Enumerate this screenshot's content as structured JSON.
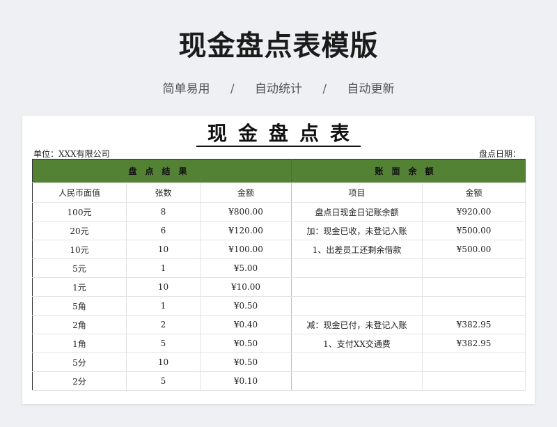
{
  "header": {
    "title": "现金盘点表模版",
    "features": [
      "简单易用",
      "自动统计",
      "自动更新"
    ],
    "separator": "/"
  },
  "sheet": {
    "title": "现金盘点表",
    "unit_label": "单位：XXX有限公司",
    "date_label": "盘点日期：",
    "section_left": "盘点结果",
    "section_right": "账面余额",
    "columns": [
      "人民币面值",
      "张数",
      "金额",
      "项目",
      "金额"
    ],
    "rows": [
      {
        "denom": "100元",
        "count": "8",
        "amount": "¥800.00",
        "item": "盘点日现金日记账余额",
        "item_amount": "¥920.00"
      },
      {
        "denom": "20元",
        "count": "6",
        "amount": "¥120.00",
        "item": "加：现金已收，未登记入账",
        "item_amount": "¥500.00"
      },
      {
        "denom": "10元",
        "count": "10",
        "amount": "¥100.00",
        "item": "1、出差员工还剩余借款",
        "item_amount": "¥500.00"
      },
      {
        "denom": "5元",
        "count": "1",
        "amount": "¥5.00",
        "item": "",
        "item_amount": ""
      },
      {
        "denom": "1元",
        "count": "10",
        "amount": "¥10.00",
        "item": "",
        "item_amount": ""
      },
      {
        "denom": "5角",
        "count": "1",
        "amount": "¥0.50",
        "item": "",
        "item_amount": ""
      },
      {
        "denom": "2角",
        "count": "2",
        "amount": "¥0.40",
        "item": "减：现金已付，未登记入账",
        "item_amount": "¥382.95"
      },
      {
        "denom": "1角",
        "count": "5",
        "amount": "¥0.50",
        "item": "1、支付XX交通费",
        "item_amount": "¥382.95"
      },
      {
        "denom": "5分",
        "count": "10",
        "amount": "¥0.50",
        "item": "",
        "item_amount": ""
      },
      {
        "denom": "2分",
        "count": "5",
        "amount": "¥0.10",
        "item": "",
        "item_amount": ""
      }
    ]
  },
  "colors": {
    "header_green": "#548235",
    "background": "#eef0f3"
  }
}
